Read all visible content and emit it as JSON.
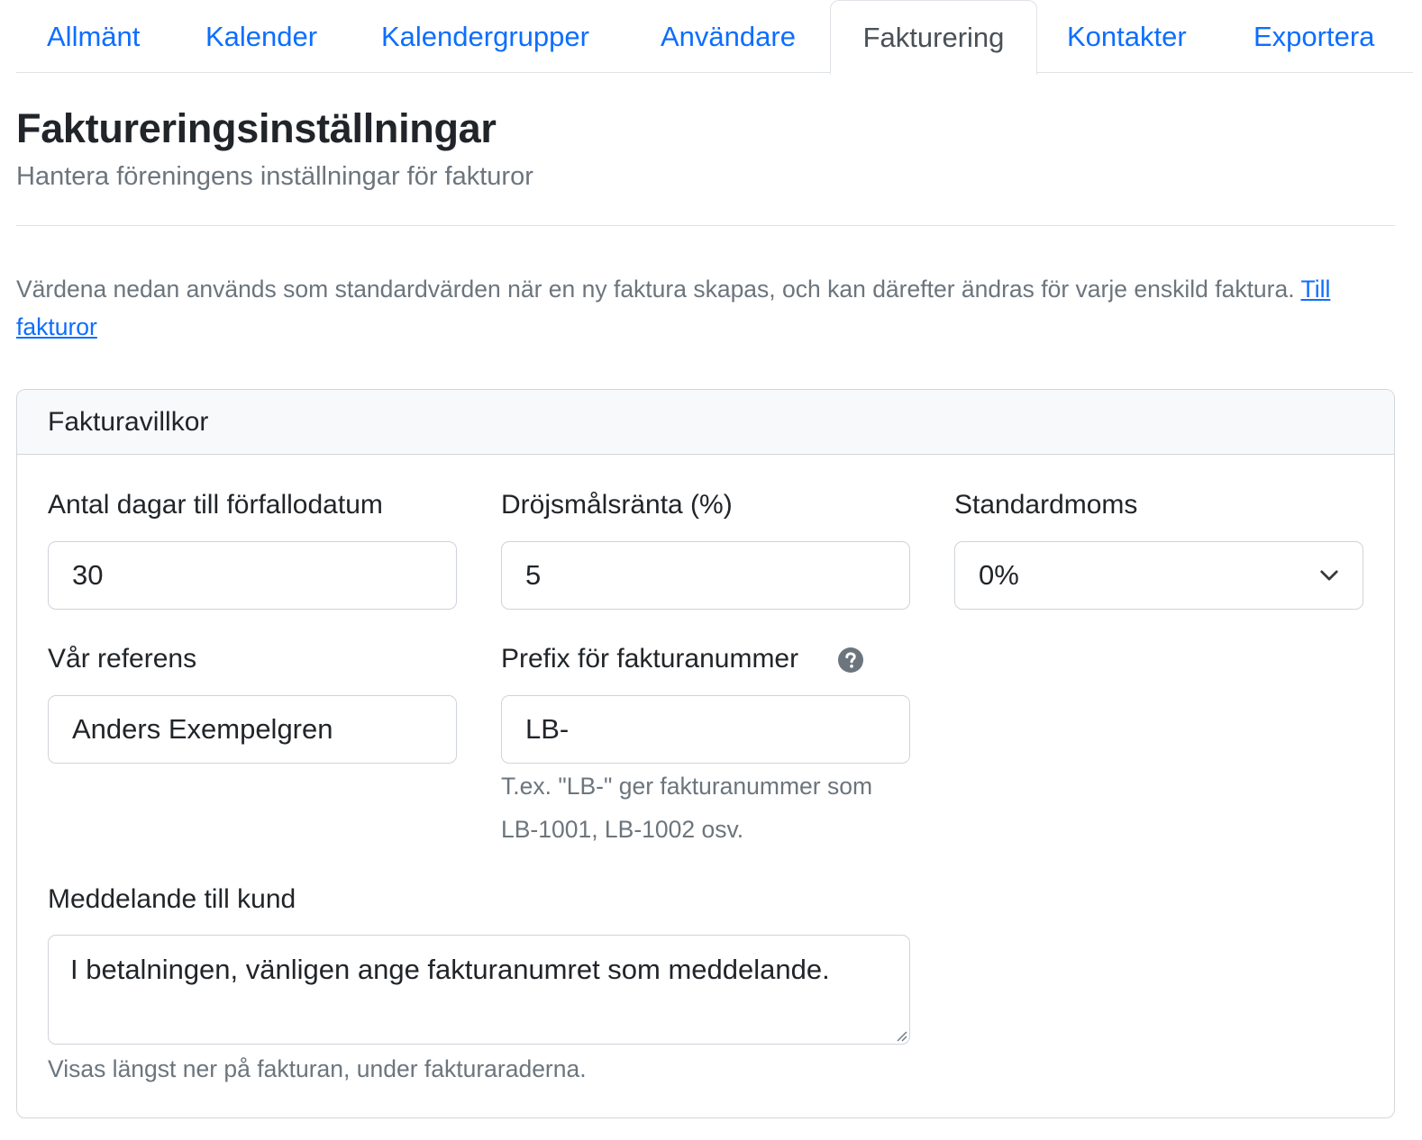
{
  "tabs": [
    {
      "label": "Allmänt"
    },
    {
      "label": "Kalender"
    },
    {
      "label": "Kalendergrupper"
    },
    {
      "label": "Användare"
    },
    {
      "label": "Fakturering",
      "active": true
    },
    {
      "label": "Kontakter"
    },
    {
      "label": "Exportera"
    }
  ],
  "header": {
    "title": "Faktureringsinställningar",
    "subtitle": "Hantera föreningens inställningar för fakturor"
  },
  "intro": {
    "text": "Värdena nedan används som standardvärden när en ny faktura skapas, och kan därefter ändras för varje enskild faktura.",
    "link_label": "Till fakturor"
  },
  "card": {
    "title": "Fakturavillkor",
    "fields": {
      "due_days": {
        "label": "Antal dagar till förfallodatum",
        "value": "30"
      },
      "interest": {
        "label": "Dröjsmålsränta (%)",
        "value": "5"
      },
      "vat": {
        "label": "Standardmoms",
        "value": "0%"
      },
      "reference": {
        "label": "Vår referens",
        "value": "Anders Exempelgren"
      },
      "prefix": {
        "label": "Prefix för fakturanummer",
        "value": "LB-",
        "help_line1": "T.ex. \"LB-\" ger fakturanummer som",
        "help_line2": "LB-1001, LB-1002 osv."
      },
      "message": {
        "label": "Meddelande till kund",
        "value": "I betalningen, vänligen ange fakturanumret som meddelande.",
        "help": "Visas längst ner på fakturan, under fakturaraderna."
      }
    }
  },
  "colors": {
    "link": "#0d6efd",
    "muted": "#6c757d",
    "border": "#dee2e6",
    "card_header_bg": "#f8f9fa",
    "text": "#212529"
  },
  "icons": {
    "vat_dropdown": "chevron-down-icon",
    "prefix_help": "question-circle-icon",
    "textarea_resize": "resize-grip-icon"
  }
}
